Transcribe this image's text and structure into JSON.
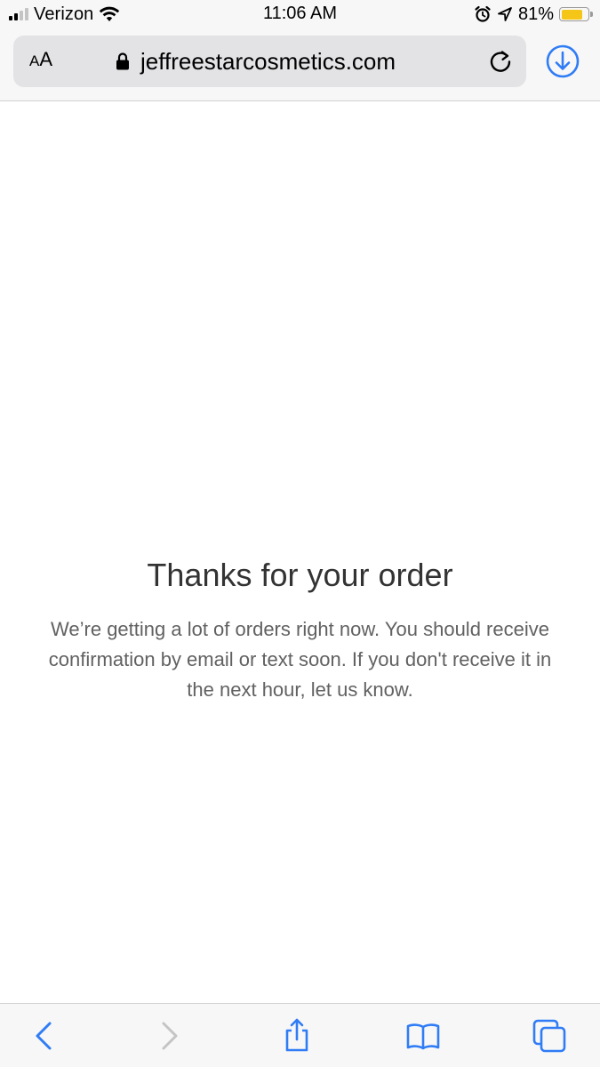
{
  "status_bar": {
    "carrier": "Verizon",
    "time": "11:06 AM",
    "battery_percent": "81%",
    "battery_level": 0.81,
    "signal_bars": 2,
    "signal_total": 4,
    "icons": [
      "signal-icon",
      "wifi-icon",
      "alarm-icon",
      "location-icon",
      "battery-icon"
    ],
    "battery_color": "#f5c518"
  },
  "url_bar": {
    "text_size_label": "AA",
    "domain": "jeffreestarcosmetics.com",
    "icons": [
      "lock-icon",
      "reload-icon",
      "download-icon"
    ],
    "accent_color": "#2f7cf6"
  },
  "page": {
    "title": "Thanks for your order",
    "message": "We’re getting a lot of orders right now. You should receive confirmation by email or text soon. If you don't receive it in the next hour, let us know."
  },
  "toolbar": {
    "icons": [
      "back-icon",
      "forward-icon",
      "share-icon",
      "bookmarks-icon",
      "tabs-icon"
    ],
    "forward_enabled": false
  }
}
